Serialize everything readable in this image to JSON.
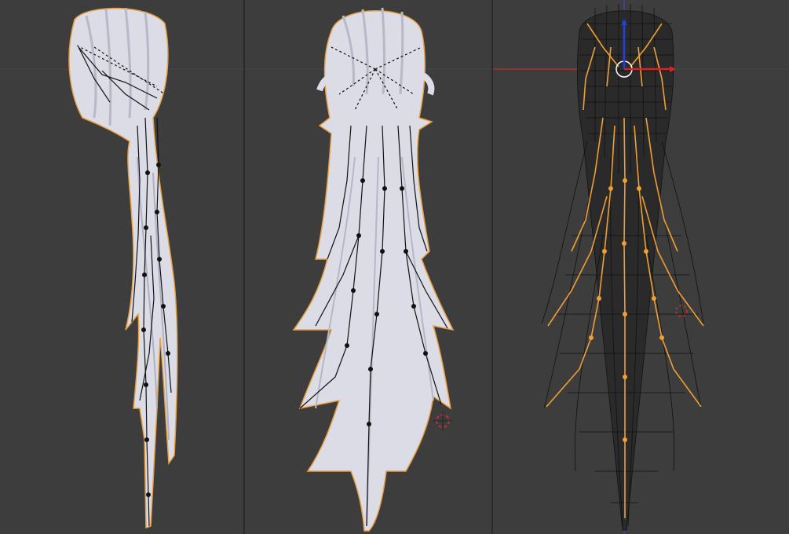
{
  "app": {
    "kind": "3D modeling viewport (Blender-like)"
  },
  "viewports": [
    {
      "id": "side",
      "shading": "solid",
      "armature_color": "#000000",
      "selected": false
    },
    {
      "id": "front",
      "shading": "solid",
      "armature_color": "#000000",
      "selected": false
    },
    {
      "id": "back-wire",
      "shading": "wireframe",
      "armature_color": "#f0a030",
      "selected": true
    }
  ],
  "colors": {
    "viewport_bg": "#3d3d3d",
    "grid_line": "#474747",
    "axis_x": "#c03030",
    "axis_z": "#3050d0",
    "mesh_fill": "#dcdce6",
    "mesh_outline": "#e8a040",
    "armature_selected": "#f0a030",
    "wire": "#111111"
  },
  "icons": {
    "cursor": "3d-cursor-icon",
    "transform_gizmo": "transform-gizmo-icon"
  }
}
